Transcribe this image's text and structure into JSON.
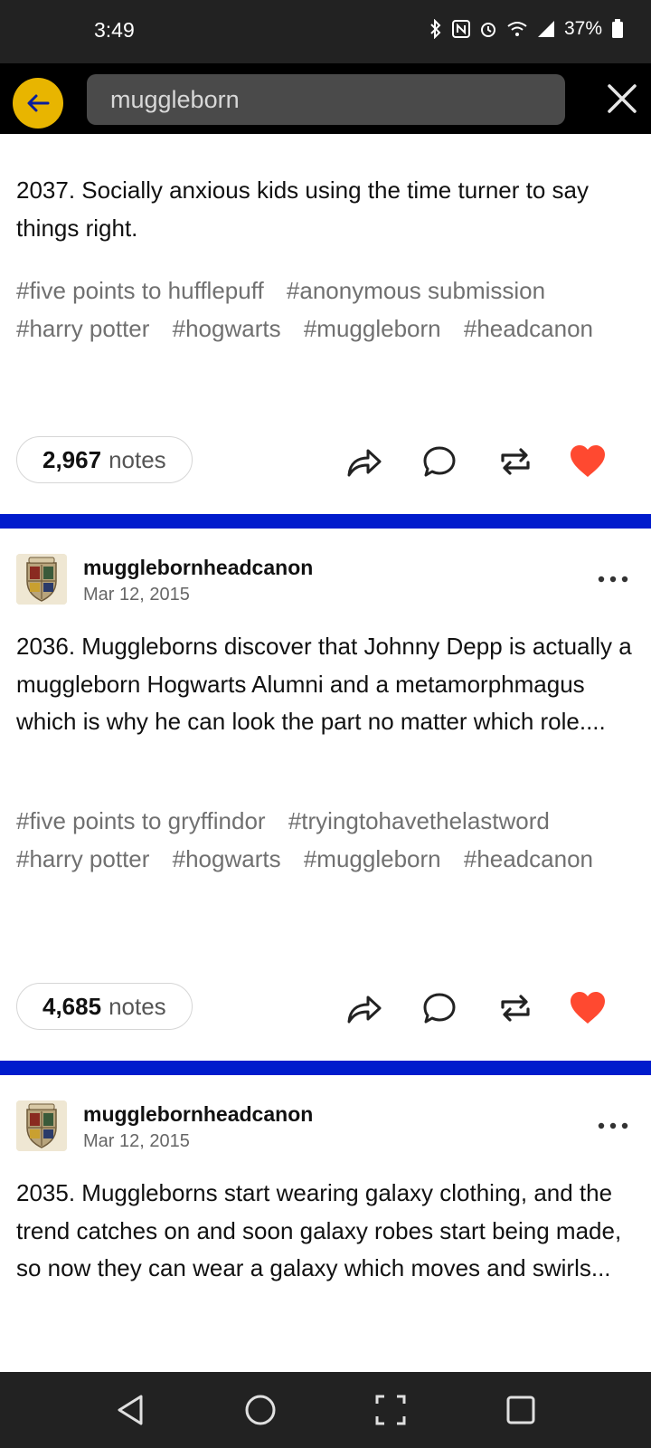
{
  "status_bar": {
    "time": "3:49",
    "battery": "37%",
    "icons": [
      "bluetooth-icon",
      "nfc-icon",
      "alarm-icon",
      "wifi-icon",
      "signal-icon",
      "battery-icon"
    ]
  },
  "search": {
    "query": "muggleborn"
  },
  "posts": [
    {
      "body": "2037. Socially anxious kids using the time turner to say things right.",
      "tags": [
        "#five points to hufflepuff",
        "#anonymous submission",
        "#harry potter",
        "#hogwarts",
        "#muggleborn",
        "#headcanon"
      ],
      "notes_count": "2,967",
      "notes_label": "notes",
      "liked": true
    },
    {
      "blog": "mugglebornheadcanon",
      "date": "Mar 12, 2015",
      "body": "2036. Muggleborns discover that Johnny Depp is actually a muggleborn Hogwarts Alumni and a metamorphmagus which is why he can look the part no matter which role....",
      "tags": [
        "#five points to gryffindor",
        "#tryingtohavethelastword",
        "#harry potter",
        "#hogwarts",
        "#muggleborn",
        "#headcanon"
      ],
      "notes_count": "4,685",
      "notes_label": "notes",
      "liked": true
    },
    {
      "blog": "mugglebornheadcanon",
      "date": "Mar 12, 2015",
      "body": "2035. Muggleborns start wearing galaxy clothing, and the trend catches on and soon galaxy robes start being made, so now they can wear a galaxy which moves and swirls..."
    }
  ],
  "colors": {
    "accent_yellow": "#e8b500",
    "divider_blue": "#001bcc",
    "like_red": "#ff4930",
    "tag_gray": "#707070"
  }
}
